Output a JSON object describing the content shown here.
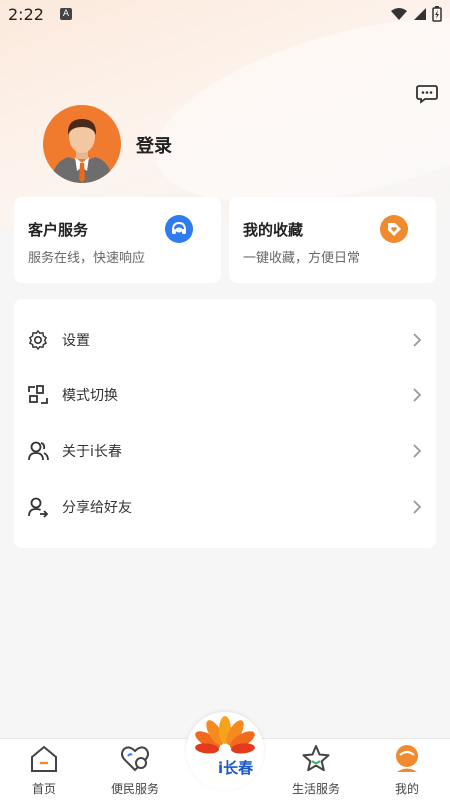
{
  "status_bar": {
    "time": "2:22",
    "notif_badge": "A"
  },
  "profile": {
    "login_label": "登录"
  },
  "cards": [
    {
      "title": "客户服务",
      "subtitle": "服务在线，快速响应",
      "icon": "headset-icon",
      "color": "#2f7bf0"
    },
    {
      "title": "我的收藏",
      "subtitle": "一键收藏，方便日常",
      "icon": "tag-heart-icon",
      "color": "#f08a2e"
    }
  ],
  "menu": [
    {
      "label": "设置",
      "icon": "gear-icon"
    },
    {
      "label": "模式切换",
      "icon": "mode-switch-icon"
    },
    {
      "label": "关于i长春",
      "icon": "people-icon"
    },
    {
      "label": "分享给好友",
      "icon": "share-user-icon"
    }
  ],
  "nav": {
    "items": [
      {
        "label": "首页",
        "icon": "home-icon"
      },
      {
        "label": "便民服务",
        "icon": "heart-hand-icon"
      },
      {
        "label": "生活服务",
        "icon": "star-icon"
      },
      {
        "label": "我的",
        "icon": "profile-icon"
      }
    ],
    "center_label": "i长春"
  },
  "colors": {
    "accent": "#f08a2e",
    "blue": "#2f7bf0",
    "brand_text": "#1b57c7"
  }
}
